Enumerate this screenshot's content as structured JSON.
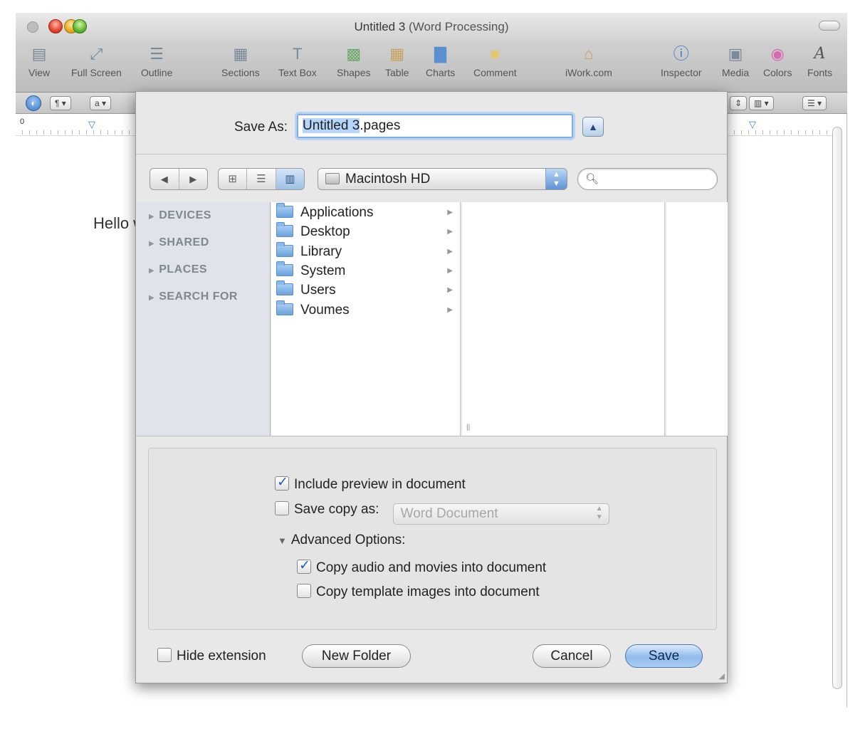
{
  "window": {
    "title": "Untitled 3",
    "subtitle": "(Word Processing)"
  },
  "toolbar": {
    "items": [
      {
        "label": "View",
        "icon": "view-icon"
      },
      {
        "label": "Full Screen",
        "icon": "fullscreen-icon"
      },
      {
        "label": "Outline",
        "icon": "outline-icon"
      },
      {
        "label": "Sections",
        "icon": "sections-icon"
      },
      {
        "label": "Text Box",
        "icon": "textbox-icon"
      },
      {
        "label": "Shapes",
        "icon": "shapes-icon"
      },
      {
        "label": "Table",
        "icon": "table-icon"
      },
      {
        "label": "Charts",
        "icon": "charts-icon"
      },
      {
        "label": "Comment",
        "icon": "comment-icon"
      },
      {
        "label": "iWork.com",
        "icon": "iwork-icon"
      },
      {
        "label": "Inspector",
        "icon": "inspector-icon"
      },
      {
        "label": "Media",
        "icon": "media-icon"
      },
      {
        "label": "Colors",
        "icon": "colors-icon"
      },
      {
        "label": "Fonts",
        "icon": "fonts-icon"
      }
    ]
  },
  "format_bar": {
    "para_btn": "¶",
    "char_btn": "a"
  },
  "ruler": {
    "zero_label": "0"
  },
  "document": {
    "text": "Hello w"
  },
  "sheet": {
    "save_as_label": "Save As:",
    "filename_selected": "Untitled 3",
    "filename_ext": ".pages",
    "location": "Macintosh HD",
    "sidebar": [
      "DEVICES",
      "SHARED",
      "PLACES",
      "SEARCH FOR"
    ],
    "files": [
      "Applications",
      "Desktop",
      "Library",
      "System",
      "Users",
      "Voumes"
    ],
    "options": {
      "include_preview_label": "Include preview in document",
      "include_preview_checked": true,
      "save_copy_label": "Save copy as:",
      "save_copy_checked": false,
      "save_copy_format": "Word Document",
      "advanced_label": "Advanced Options:",
      "copy_audio_label": "Copy audio and movies into document",
      "copy_audio_checked": true,
      "copy_template_label": "Copy template images into document",
      "copy_template_checked": false
    },
    "hide_extension_label": "Hide extension",
    "hide_extension_checked": false,
    "new_folder_label": "New Folder",
    "cancel_label": "Cancel",
    "save_label": "Save"
  }
}
